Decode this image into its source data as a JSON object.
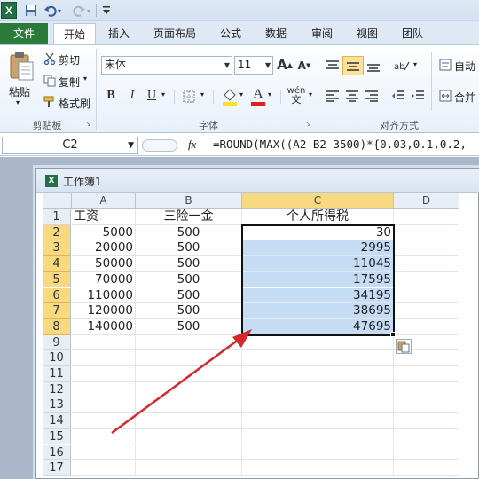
{
  "quick_access": {
    "logo": "X",
    "dropdown": "▾"
  },
  "tabs": [
    "文件",
    "开始",
    "插入",
    "页面布局",
    "公式",
    "数据",
    "审阅",
    "视图",
    "团队"
  ],
  "ribbon": {
    "clipboard": {
      "paste_label": "粘贴",
      "cut_label": "剪切",
      "copy_label": "复制",
      "format_painter_label": "格式刷",
      "group_label": "剪贴板"
    },
    "font": {
      "font_name": "宋体",
      "font_size": "11",
      "grow_label": "A",
      "shrink_label": "A",
      "bold": "B",
      "italic": "I",
      "underline": "U",
      "font_color_label": "A",
      "wen_label": "wén",
      "group_label": "字体"
    },
    "alignment": {
      "wrap_label": "自动",
      "merge_label": "合并",
      "group_label": "对齐方式"
    }
  },
  "formula_bar": {
    "name_box": "C2",
    "fx": "fx",
    "formula": "=ROUND(MAX((A2-B2-3500)*{0.03,0.1,0.2,"
  },
  "workbook": {
    "title": "工作簿1"
  },
  "columns": [
    "A",
    "B",
    "C",
    "D"
  ],
  "rows": [
    "1",
    "2",
    "3",
    "4",
    "5",
    "6",
    "7",
    "8",
    "9",
    "10",
    "11",
    "12",
    "13",
    "14",
    "15",
    "16",
    "17"
  ],
  "headers": {
    "a1": "工资",
    "b1": "三险一金",
    "c1": "个人所得税"
  },
  "data": [
    {
      "a": "5000",
      "b": "500",
      "c": "30"
    },
    {
      "a": "20000",
      "b": "500",
      "c": "2995"
    },
    {
      "a": "50000",
      "b": "500",
      "c": "11045"
    },
    {
      "a": "70000",
      "b": "500",
      "c": "17595"
    },
    {
      "a": "110000",
      "b": "500",
      "c": "34195"
    },
    {
      "a": "120000",
      "b": "500",
      "c": "38695"
    },
    {
      "a": "140000",
      "b": "500",
      "c": "47695"
    }
  ],
  "colors": {
    "accent_green": "#2a7b3a",
    "selection_fill": "#c6dcf4",
    "header_highlight": "#f9d980",
    "arrow_red": "#d42a2a"
  },
  "icons": [
    "excel-logo-icon",
    "save-icon",
    "undo-icon",
    "redo-icon",
    "customize-icon",
    "paste-icon",
    "cut-icon",
    "copy-icon",
    "format-painter-icon",
    "border-icon",
    "fill-color-icon",
    "align-icon",
    "paste-options-icon",
    "red-arrow-annotation"
  ]
}
